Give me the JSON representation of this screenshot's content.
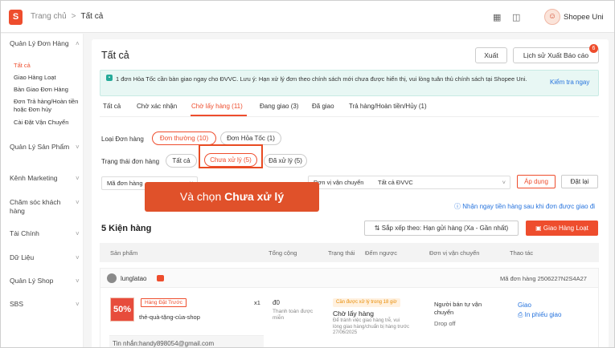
{
  "topbar": {
    "logo": "S",
    "breadcrumb_home": "Trang chủ",
    "breadcrumb_sep": ">",
    "breadcrumb_current": "Tất cả",
    "icons": [
      "grid-icon",
      "book-icon"
    ],
    "user_name": "Shopee Uni"
  },
  "sidebar": {
    "sections": [
      {
        "label": "Quản Lý Đơn Hàng",
        "items": [
          "Tất cả",
          "Giao Hàng Loạt",
          "Bàn Giao Đơn Hàng",
          "Đơn Trả hàng/Hoàn tiền hoặc Đơn hủy",
          "Cài Đặt Vận Chuyển"
        ]
      },
      {
        "label": "Quản Lý Sản Phẩm"
      },
      {
        "label": "Kênh Marketing"
      },
      {
        "label": "Chăm sóc khách hàng"
      },
      {
        "label": "Tài Chính"
      },
      {
        "label": "Dữ Liệu"
      },
      {
        "label": "Quản Lý Shop"
      },
      {
        "label": "SBS"
      }
    ]
  },
  "main": {
    "title": "Tất cả",
    "export_label": "Xuất",
    "history_label": "Lịch sử Xuất Báo cáo",
    "history_badge": "6",
    "notice_text": "1 đơn Hỏa Tốc cần bàn giao ngay cho ĐVVC. Lưu ý: Hạn xử lý đơn theo chính sách mới chưa được hiển thị, vui lòng tuân thủ chính sách tại Shopee Uni.",
    "notice_link": "Kiểm tra ngay",
    "tabs": [
      "Tất cả",
      "Chờ xác nhận",
      "Chờ lấy hàng (11)",
      "Đang giao (3)",
      "Đã giao",
      "Trả hàng/Hoàn tiền/Hủy (1)"
    ],
    "active_tab": 2,
    "order_type_label": "Loại Đơn hàng",
    "order_type_options": [
      "Đơn thường (10)",
      "Đơn Hỏa Tốc (1)"
    ],
    "status_label": "Trạng thái đơn hàng",
    "status_options": [
      "Tất cả",
      "Chưa xử lý (5)",
      "Đã xử lý (5)"
    ],
    "search_field": "Mã đơn hàng",
    "carrier_label": "Đơn vị vận chuyển",
    "carrier_value": "Tất cả ĐVVC",
    "apply_label": "Áp dụng",
    "reset_label": "Đặt lại",
    "overlay_text_prefix": "Và chọn ",
    "overlay_text_bold": "Chưa xử lý",
    "promo_link": "Nhận ngay tiền hàng sau khi đơn được giao đi",
    "count_title": "5 Kiện hàng",
    "sort_label": "Sắp xếp theo: Hạn gửi hàng (Xa - Gần nhất)",
    "bulk_label": "Giao Hàng Loạt",
    "columns": [
      "Sản phẩm",
      "Tổng cộng",
      "Trạng thái",
      "Đếm ngược",
      "Đơn vị vận chuyển",
      "Thao tác"
    ],
    "order": {
      "buyer": "lunglatao",
      "order_id": "Mã đơn hàng 2506227N2S4A27",
      "thumb_text": "50%",
      "tag": "Hàng Đặt Trước",
      "product": "thẻ-quà-tặng-của-shop",
      "qty": "x1",
      "price": "đ0",
      "payment": "Thanh toán được miễn",
      "status_badge": "Cần được xử lý trong 18 giờ",
      "status_title": "Chờ lấy hàng",
      "status_desc": "Để tránh việc giao hàng trễ, vui lòng giao hàng/chuẩn bị hàng trước 27/06/2025",
      "carrier": "Người bán tự vận chuyển",
      "carrier_sub": "Drop off",
      "action_1": "Giao",
      "action_2": "In phiếu giao",
      "message": "Tin nhắn:handy898054@gmail.com"
    }
  }
}
